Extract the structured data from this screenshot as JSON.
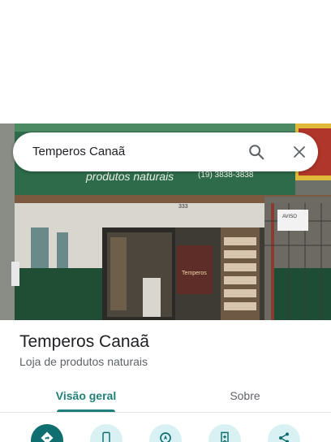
{
  "search": {
    "query": "Temperos Canaã",
    "search_icon": "search-icon",
    "close_icon": "close-icon"
  },
  "photo": {
    "banner_text": "produtos naturais",
    "banner_phone": "(19) 3838-3838",
    "door_number": "333",
    "notice_text": "AVISO",
    "poster_text": "Temperos"
  },
  "place": {
    "name": "Temperos Canaã",
    "category": "Loja de produtos naturais"
  },
  "tabs": [
    {
      "label": "Visão geral",
      "active": true
    },
    {
      "label": "Sobre",
      "active": false
    }
  ],
  "actions": [
    {
      "icon": "directions-icon"
    },
    {
      "icon": "phone-icon"
    },
    {
      "icon": "start-navigation-icon"
    },
    {
      "icon": "save-bookmark-icon"
    },
    {
      "icon": "share-icon"
    }
  ],
  "colors": {
    "accent": "#1f7f7a",
    "action_primary": "#0f6e70",
    "action_bg": "#d9f1f2"
  }
}
